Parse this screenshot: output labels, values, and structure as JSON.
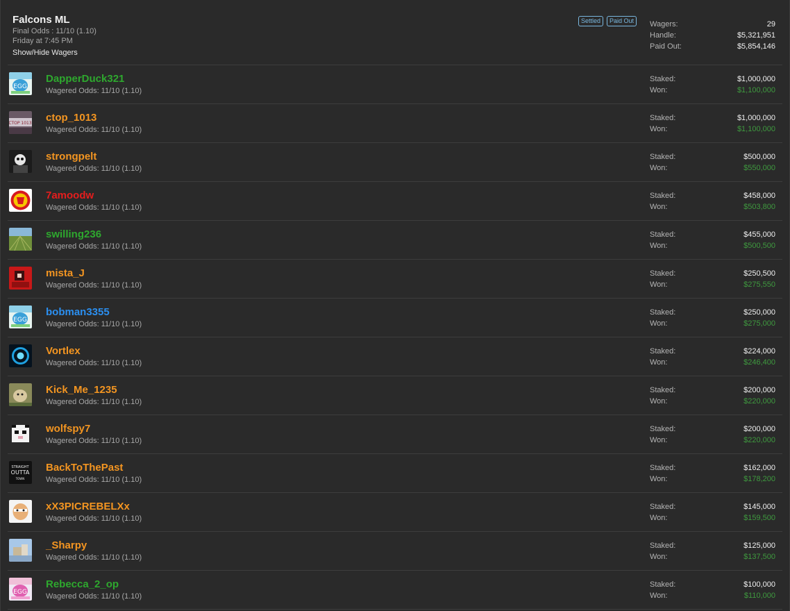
{
  "header": {
    "title": "Falcons ML",
    "final_odds": "Final Odds : 11/10 (1.10)",
    "time": "Friday at 7:45 PM",
    "toggle": "Show/Hide Wagers",
    "badges": [
      "Settled",
      "Paid Out"
    ],
    "stats": {
      "wagers_label": "Wagers:",
      "wagers": "29",
      "handle_label": "Handle:",
      "handle": "$5,321,951",
      "paid_label": "Paid Out:",
      "paid": "$5,854,146"
    }
  },
  "labels": {
    "staked": "Staked:",
    "won": "Won:"
  },
  "colors": {
    "green": "#2ea82e",
    "orange": "#f39521",
    "red": "#e51d1d",
    "blue": "#2b8ff0",
    "won": "#3f9a3f"
  },
  "wagers": [
    {
      "user": "DapperDuck321",
      "color": "green",
      "odds": "Wagered Odds: 11/10 (1.10)",
      "staked": "$1,000,000",
      "won": "$1,100,000",
      "avatar": "egg-blue"
    },
    {
      "user": "ctop_1013",
      "color": "orange",
      "odds": "Wagered Odds: 11/10 (1.10)",
      "staked": "$1,000,000",
      "won": "$1,100,000",
      "avatar": "ctop"
    },
    {
      "user": "strongpelt",
      "color": "orange",
      "odds": "Wagered Odds: 11/10 (1.10)",
      "staked": "$500,000",
      "won": "$550,000",
      "avatar": "dark-figure"
    },
    {
      "user": "7amoodw",
      "color": "red",
      "odds": "Wagered Odds: 11/10 (1.10)",
      "staked": "$458,000",
      "won": "$503,800",
      "avatar": "crest"
    },
    {
      "user": "swilling236",
      "color": "green",
      "odds": "Wagered Odds: 11/10 (1.10)",
      "staked": "$455,000",
      "won": "$500,500",
      "avatar": "field"
    },
    {
      "user": "mista_J",
      "color": "orange",
      "odds": "Wagered Odds: 11/10 (1.10)",
      "staked": "$250,500",
      "won": "$275,550",
      "avatar": "red-art"
    },
    {
      "user": "bobman3355",
      "color": "blue",
      "odds": "Wagered Odds: 11/10 (1.10)",
      "staked": "$250,000",
      "won": "$275,000",
      "avatar": "egg-blue"
    },
    {
      "user": "Vortlex",
      "color": "orange",
      "odds": "Wagered Odds: 11/10 (1.10)",
      "staked": "$224,000",
      "won": "$246,400",
      "avatar": "vortex"
    },
    {
      "user": "Kick_Me_1235",
      "color": "orange",
      "odds": "Wagered Odds: 11/10 (1.10)",
      "staked": "$200,000",
      "won": "$220,000",
      "avatar": "animal"
    },
    {
      "user": "wolfspy7",
      "color": "orange",
      "odds": "Wagered Odds: 11/10 (1.10)",
      "staked": "$200,000",
      "won": "$220,000",
      "avatar": "pixel-wolf"
    },
    {
      "user": "BackToThePast",
      "color": "orange",
      "odds": "Wagered Odds: 11/10 (1.10)",
      "staked": "$162,000",
      "won": "$178,200",
      "avatar": "poster"
    },
    {
      "user": "xX3PICREBELXx",
      "color": "orange",
      "odds": "Wagered Odds: 11/10 (1.10)",
      "staked": "$145,000",
      "won": "$159,500",
      "avatar": "face"
    },
    {
      "user": "_Sharpy",
      "color": "orange",
      "odds": "Wagered Odds: 11/10 (1.10)",
      "staked": "$125,000",
      "won": "$137,500",
      "avatar": "sky"
    },
    {
      "user": "Rebecca_2_op",
      "color": "green",
      "odds": "Wagered Odds: 11/10 (1.10)",
      "staked": "$100,000",
      "won": "$110,000",
      "avatar": "egg-pink"
    }
  ]
}
